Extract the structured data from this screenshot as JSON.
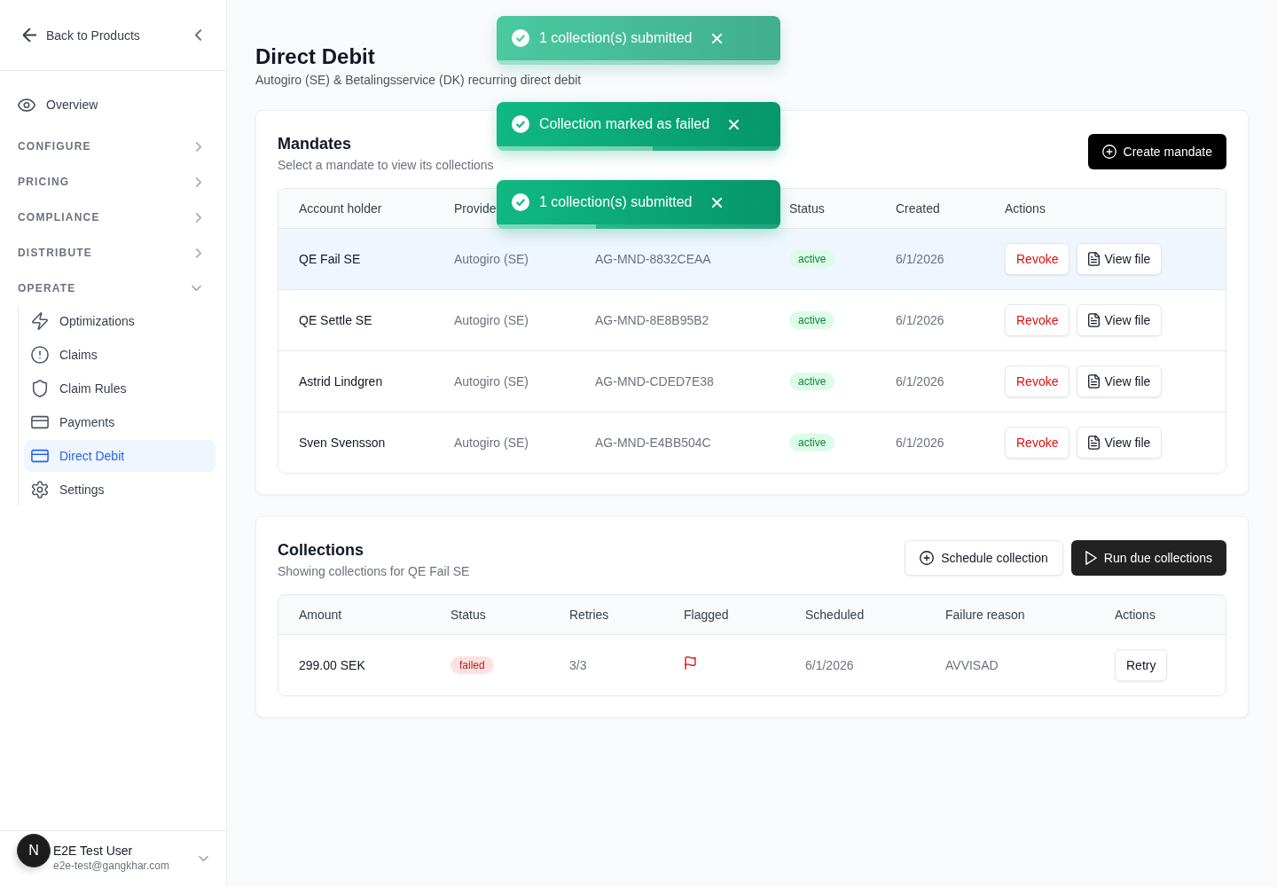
{
  "sidebar": {
    "back_label": "Back to Products",
    "nav": [
      {
        "kind": "link",
        "label": "Overview",
        "selected": false
      },
      {
        "kind": "section",
        "label": "CONFIGURE",
        "expanded": false
      },
      {
        "kind": "section",
        "label": "PRICING",
        "expanded": false
      },
      {
        "kind": "section",
        "label": "COMPLIANCE",
        "expanded": false
      },
      {
        "kind": "section",
        "label": "DISTRIBUTE",
        "expanded": false
      },
      {
        "kind": "section",
        "label": "OPERATE",
        "expanded": true,
        "children": [
          {
            "label": "Optimizations",
            "selected": false
          },
          {
            "label": "Claims",
            "selected": false
          },
          {
            "label": "Claim Rules",
            "selected": false
          },
          {
            "label": "Payments",
            "selected": false
          },
          {
            "label": "Direct Debit",
            "selected": true
          },
          {
            "label": "Settings",
            "selected": false
          }
        ]
      }
    ],
    "user": {
      "initial": "N",
      "name": "E2E Test User",
      "email": "e2e-test@gangkhar.com"
    }
  },
  "page": {
    "title": "Direct Debit",
    "subtitle": "Autogiro (SE) & Betalingsservice (DK) recurring direct debit"
  },
  "toasts": [
    {
      "message": "1 collection(s) submitted",
      "level": 1,
      "leaving": true
    },
    {
      "message": "Collection marked as failed",
      "level": 0.55,
      "leaving": false
    },
    {
      "message": "1 collection(s) submitted",
      "level": 0.35,
      "leaving": false
    }
  ],
  "mandates": {
    "title": "Mandates",
    "subtitle": "Select a mandate to view its collections",
    "create_button": "Create mandate",
    "columns": [
      {
        "label": "Account holder"
      },
      {
        "label": "Provide"
      },
      {},
      {
        "label": "Status"
      },
      {
        "label": "Created"
      },
      {
        "label": "Actions"
      }
    ],
    "rows": [
      {
        "selected": true,
        "account_holder": "QE Fail SE",
        "provider": "Autogiro (SE)",
        "reference": "AG-MND-8832CEAA",
        "status": {
          "label": "active",
          "kind": "success"
        },
        "created": "6/1/2026",
        "actions": [
          {
            "kind": "danger",
            "label": "Revoke"
          },
          {
            "kind": "file",
            "label": "View file"
          }
        ]
      },
      {
        "selected": false,
        "account_holder": "QE Settle SE",
        "provider": "Autogiro (SE)",
        "reference": "AG-MND-8E8B95B2",
        "status": {
          "label": "active",
          "kind": "success"
        },
        "created": "6/1/2026",
        "actions": [
          {
            "kind": "danger",
            "label": "Revoke"
          },
          {
            "kind": "file",
            "label": "View file"
          }
        ]
      },
      {
        "selected": false,
        "account_holder": "Astrid Lindgren",
        "provider": "Autogiro (SE)",
        "reference": "AG-MND-CDED7E38",
        "status": {
          "label": "active",
          "kind": "success"
        },
        "created": "6/1/2026",
        "actions": [
          {
            "kind": "danger",
            "label": "Revoke"
          },
          {
            "kind": "file",
            "label": "View file"
          }
        ]
      },
      {
        "selected": false,
        "account_holder": "Sven Svensson",
        "provider": "Autogiro (SE)",
        "reference": "AG-MND-E4BB504C",
        "status": {
          "label": "active",
          "kind": "success"
        },
        "created": "6/1/2026",
        "actions": [
          {
            "kind": "danger",
            "label": "Revoke"
          },
          {
            "kind": "file",
            "label": "View file"
          }
        ]
      }
    ]
  },
  "collections": {
    "title": "Collections",
    "subtitle": "Showing collections for QE Fail SE",
    "buttons": [
      {
        "kind": "secondary",
        "label": "Schedule collection"
      },
      {
        "kind": "primary",
        "label": "Run due collections"
      }
    ],
    "columns": [
      "Amount",
      "Status",
      "Retries",
      "Flagged",
      "Scheduled",
      "Failure reason",
      "Actions"
    ],
    "rows": [
      {
        "amount": "299.00 SEK",
        "status": {
          "label": "failed",
          "kind": "danger"
        },
        "retries": "3/3",
        "flagged": true,
        "scheduled": "6/1/2026",
        "failure_reason": "AVVISAD",
        "actions": [
          {
            "kind": "plain",
            "label": "Retry"
          }
        ]
      }
    ]
  }
}
